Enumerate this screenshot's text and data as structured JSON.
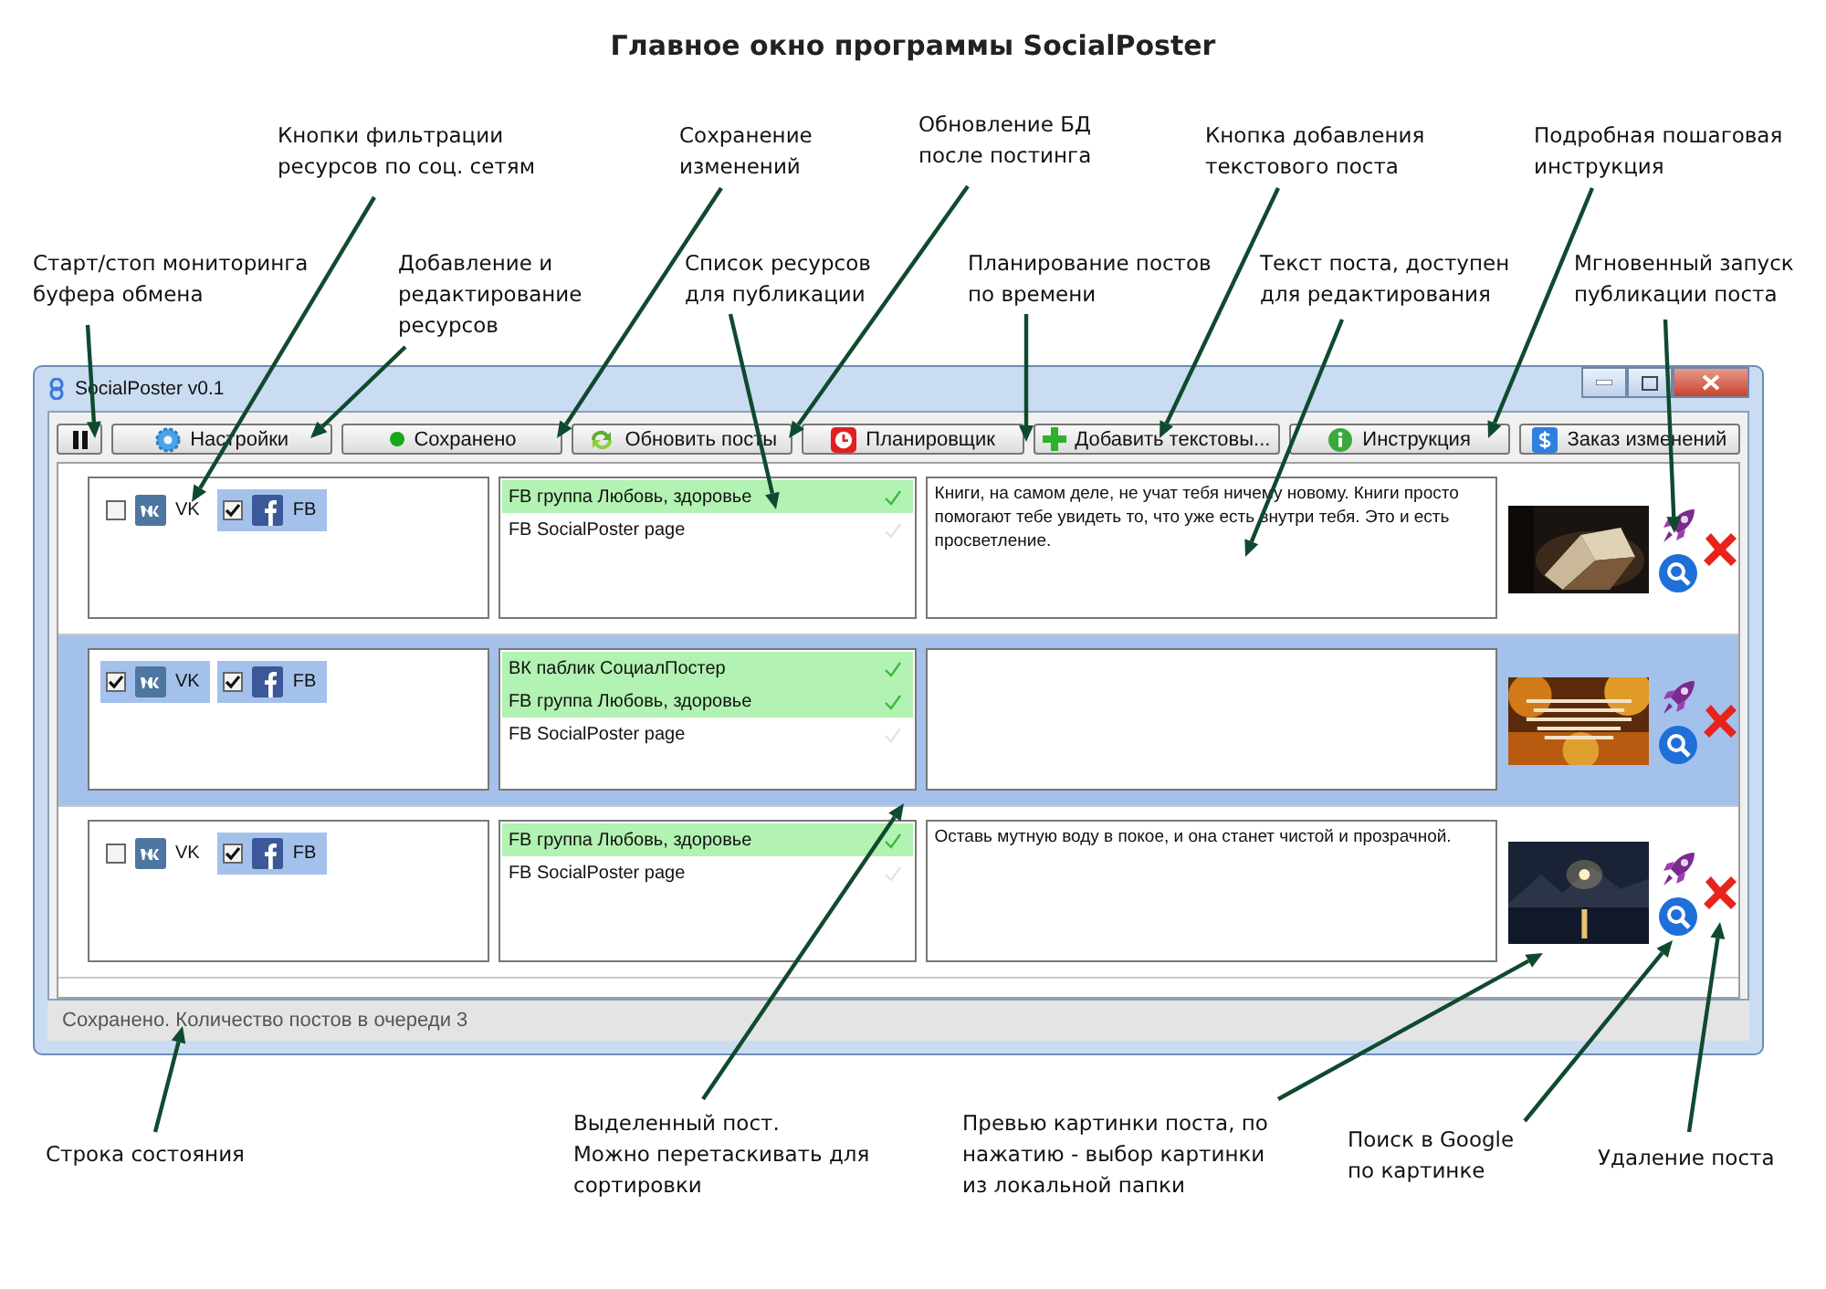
{
  "title": "Главное окно программы SocialPoster",
  "window": {
    "title": "SocialPoster v0.1"
  },
  "toolbar": [
    {
      "kind": "pause"
    },
    {
      "kind": "gear",
      "label": "Настройки"
    },
    {
      "kind": "dot",
      "label": "Сохранено"
    },
    {
      "kind": "refresh",
      "label": "Обновить посты"
    },
    {
      "kind": "clock",
      "label": "Планировщик"
    },
    {
      "kind": "plus",
      "label": "Добавить текстовы..."
    },
    {
      "kind": "info",
      "label": "Инструкция"
    },
    {
      "kind": "dollar",
      "label": "Заказ изменений"
    }
  ],
  "posts": [
    {
      "selected": false,
      "networks": [
        {
          "kind": "vk",
          "label": "VK",
          "checked": false
        },
        {
          "kind": "fb",
          "label": "FB",
          "checked": true
        }
      ],
      "resources": [
        {
          "label": "FB группа Любовь, здоровье",
          "selected": true
        },
        {
          "label": "FB SocialPoster page",
          "selected": false
        }
      ],
      "text": "Книги, на самом деле, не учат тебя ничему новому. Книги просто помогают тебе увидеть то, что уже есть внутри тебя. Это и есть просветление."
    },
    {
      "selected": true,
      "networks": [
        {
          "kind": "vk",
          "label": "VK",
          "checked": true
        },
        {
          "kind": "fb",
          "label": "FB",
          "checked": true
        }
      ],
      "resources": [
        {
          "label": "ВК паблик СоциалПостер",
          "selected": true
        },
        {
          "label": "FB группа Любовь, здоровье",
          "selected": true
        },
        {
          "label": "FB SocialPoster page",
          "selected": false
        }
      ]
    },
    {
      "selected": false,
      "networks": [
        {
          "kind": "vk",
          "label": "VK",
          "checked": false
        },
        {
          "kind": "fb",
          "label": "FB",
          "checked": true
        }
      ],
      "resources": [
        {
          "label": "FB группа Любовь, здоровье",
          "selected": true
        },
        {
          "label": "FB SocialPoster page",
          "selected": false
        }
      ],
      "text": "Оставь мутную воду в покое, и она станет чистой и прозрачной."
    }
  ],
  "status_bar": "Сохранено. Количество постов в очереди 3",
  "callouts": [
    {
      "text": "Кнопки фильтрации\nресурсов по соц. сетям"
    },
    {
      "text": "Сохранение\nизменений"
    },
    {
      "text": "Обновление БД\nпосле постинга"
    },
    {
      "text": "Кнопка добавления\nтекстового поста"
    },
    {
      "text": "Подробная пошаговая\nинструкция"
    },
    {
      "text": "Старт/стоп мониторинга\nбуфера обмена"
    },
    {
      "text": "Добавление и\nредактирование\nресурсов"
    },
    {
      "text": "Список ресурсов\nдля публикации"
    },
    {
      "text": "Планирование постов\nпо времени"
    },
    {
      "text": "Текст поста, доступен\nдля редактирования"
    },
    {
      "text": "Мгновенный запуск\nпубликации поста"
    },
    {
      "text": "Строка состояния"
    },
    {
      "text": "Выделенный пост.\nМожно перетаскивать для\nсортировки"
    },
    {
      "text": "Превью картинки поста, по\nнажатию - выбор картинки\nиз локальной папки"
    },
    {
      "text": "Поиск в Google\nпо картинке"
    },
    {
      "text": "Удаление поста"
    }
  ]
}
